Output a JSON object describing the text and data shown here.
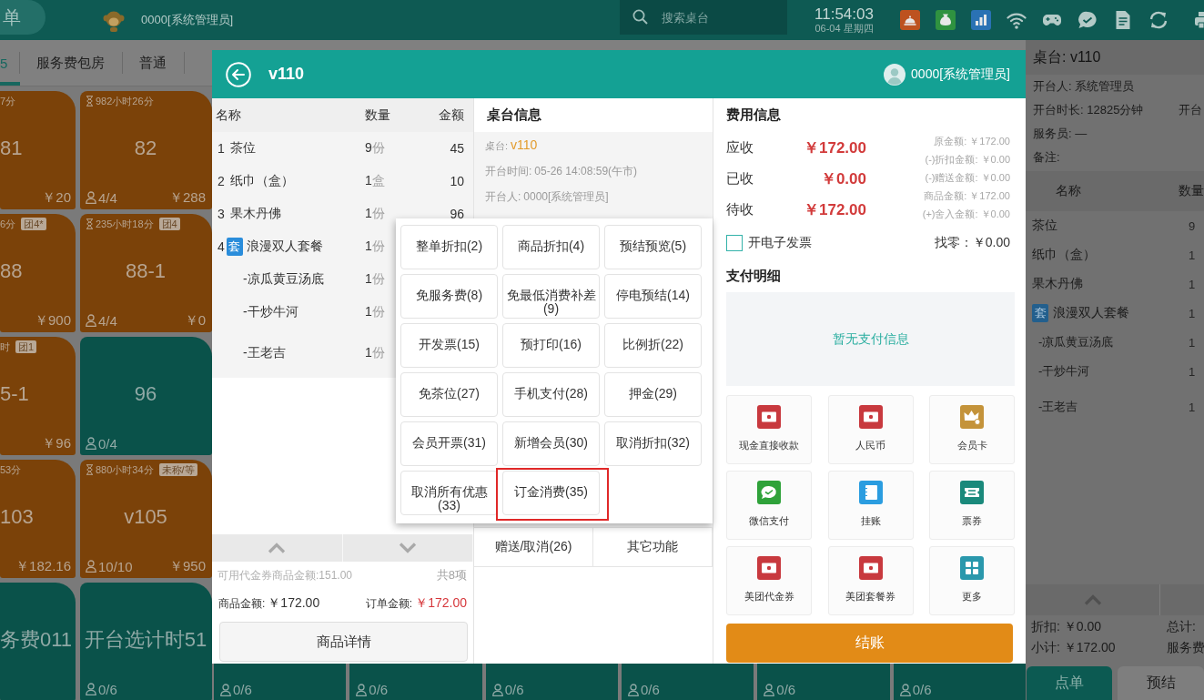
{
  "top_bar": {
    "menu_label": "单",
    "user": "0000[系统管理员]",
    "search": {
      "placeholder": "搜索桌台"
    },
    "time": "11:54:03",
    "date": "06-04 星期四"
  },
  "category_tabs": [
    {
      "label": "5",
      "selected": true
    },
    {
      "label": "服务费包房",
      "selected": false
    },
    {
      "label": "普通",
      "selected": false
    }
  ],
  "tiles": [
    {
      "color": "#7b4209",
      "timer": "7分",
      "name": "81",
      "amount": "￥20"
    },
    {
      "color": "#7b4209",
      "timer": "982小时26分",
      "name": "82",
      "guests": "4/4",
      "amount": "￥288"
    },
    {
      "color": "#7b4209",
      "timer": "6分",
      "badge": "团4*",
      "name": "88",
      "amount": "￥900"
    },
    {
      "color": "#7b4209",
      "timer": "235小时18分",
      "badge": "团4",
      "name": "88-1",
      "guests": "4/4",
      "amount": "￥0"
    },
    {
      "color": "#7b4209",
      "timer": "时",
      "badge": "团1",
      "name": "5-1",
      "amount": "￥96"
    },
    {
      "color": "#0a524a",
      "name": "96",
      "guests": "0/4"
    },
    {
      "color": "#7b4209",
      "timer": "53分",
      "name": "103",
      "amount": "￥182.16"
    },
    {
      "color": "#7b4209",
      "timer": "880小时34分",
      "badge": "未称/等",
      "name": "v105",
      "guests": "10/10",
      "amount": "￥950"
    },
    {
      "color": "#0a524a",
      "name": "务费011"
    },
    {
      "color": "#0a524a",
      "name": "开台选计时51",
      "guests": "0/6"
    }
  ],
  "bottom_tiles": [
    {
      "color": "#0a524a",
      "guests": "0/6"
    },
    {
      "color": "#0a524a",
      "guests": "0/6"
    },
    {
      "color": "#0a524a",
      "guests": "0/6"
    },
    {
      "color": "#0a524a",
      "guests": "0/6"
    },
    {
      "color": "#0a524a",
      "guests": "0/6"
    },
    {
      "color": "#0a524a",
      "guests": "0/6"
    }
  ],
  "side_panel": {
    "title": "桌台: v110",
    "info_rows": [
      [
        "开台人: 系统管理员"
      ],
      [
        "开台时长: 12825分钟",
        "开台"
      ],
      [
        "服务员: —"
      ],
      [
        "备注:"
      ]
    ],
    "columns": [
      "名称",
      "数量"
    ],
    "items": [
      {
        "name": "茶位",
        "qty": "9"
      },
      {
        "name": "纸巾（盒）",
        "qty": "1"
      },
      {
        "name": "果木丹佛",
        "qty": "1"
      },
      {
        "tag": "套",
        "name": "浪漫双人套餐",
        "qty": "1",
        "children": [
          {
            "name": "-凉瓜黄豆汤底",
            "qty": "1"
          },
          {
            "name": "-干炒牛河",
            "qty": "1"
          },
          {
            "name": "-王老吉",
            "qty": "1"
          }
        ]
      }
    ],
    "totals": [
      [
        "折扣: ￥0.00",
        "总计:"
      ],
      [
        "小计: ￥172.00",
        "服务费"
      ]
    ],
    "buttons": [
      {
        "label": "点单",
        "kind": "primary"
      },
      {
        "label": "预结",
        "kind": "secondary"
      }
    ]
  },
  "modal": {
    "title": "v110",
    "user": "0000[系统管理员]",
    "order": {
      "columns": [
        "名称",
        "数量",
        "金额"
      ],
      "items": [
        {
          "index": "1",
          "name": "茶位",
          "qty": "9",
          "unit": "份",
          "amount": "45"
        },
        {
          "index": "2",
          "name": "纸巾（盒）",
          "qty": "1",
          "unit": "盒",
          "amount": "10"
        },
        {
          "index": "3",
          "name": "果木丹佛",
          "qty": "1",
          "unit": "份",
          "amount": "96"
        },
        {
          "index": "4",
          "tag": "套",
          "name": "浪漫双人套餐",
          "qty": "1",
          "unit": "份",
          "children": [
            {
              "name": "-凉瓜黄豆汤底",
              "qty": "1",
              "unit": "份"
            },
            {
              "name": "-干炒牛河",
              "qty": "1",
              "unit": "份"
            },
            {
              "name": "-王老吉",
              "qty": "1",
              "unit": "份"
            }
          ]
        }
      ]
    },
    "voucher_note": "可用代金券商品金额:151.00",
    "item_count": "共8项",
    "totals": [
      {
        "label": "商品金额:",
        "amount": "￥172.00",
        "kind": "plain"
      },
      {
        "label": "订单金额:",
        "amount": "￥172.00",
        "kind": "alert"
      }
    ],
    "detail_button": "商品详情",
    "table_info": {
      "heading": "桌台信息",
      "fields": [
        {
          "label": "桌台:",
          "value": "v110",
          "kind": "accent"
        },
        {
          "label": "开台时间:",
          "value": "05-26 14:08:59(午市)",
          "kind": "plain"
        },
        {
          "label": "开台人:",
          "value": "0000[系统管理员]",
          "kind": "plain"
        }
      ]
    },
    "actions": [
      "赠送/取消(26)",
      "其它功能"
    ],
    "function_menu": [
      {
        "label": "整单折扣(2)",
        "highlighted": false
      },
      {
        "label": "商品折扣(4)",
        "highlighted": false
      },
      {
        "label": "预结预览(5)",
        "highlighted": false
      },
      {
        "label": "免服务费(8)",
        "highlighted": false
      },
      {
        "label": "免最低消费补差(9)",
        "highlighted": false
      },
      {
        "label": "停电预结(14)",
        "highlighted": false
      },
      {
        "label": "开发票(15)",
        "highlighted": false
      },
      {
        "label": "预打印(16)",
        "highlighted": false
      },
      {
        "label": "比例折(22)",
        "highlighted": false
      },
      {
        "label": "免茶位(27)",
        "highlighted": false
      },
      {
        "label": "手机支付(28)",
        "highlighted": false
      },
      {
        "label": "押金(29)",
        "highlighted": false
      },
      {
        "label": "会员开票(31)",
        "highlighted": false
      },
      {
        "label": "新增会员(30)",
        "highlighted": false
      },
      {
        "label": "取消折扣(32)",
        "highlighted": false
      },
      {
        "label": "取消所有优惠(33)",
        "highlighted": false
      },
      {
        "label": "订金消费(35)",
        "highlighted": true
      }
    ],
    "fees": {
      "heading": "费用信息",
      "rows": [
        {
          "label": "应收",
          "amount": "￥172.00"
        },
        {
          "label": "已收",
          "amount": "￥0.00"
        },
        {
          "label": "待收",
          "amount": "￥172.00"
        }
      ],
      "breakdown": [
        "原金额: ￥172.00",
        "(-)折扣金额: ￥0.00",
        "(-)赠送金额: ￥0.00",
        "商品金额: ￥172.00",
        "(+)舍入金额: ￥0.00"
      ],
      "invoice": {
        "label": "开电子发票",
        "checked": false
      },
      "change": "找零：￥0.00"
    },
    "payment": {
      "heading": "支付明细",
      "empty_text": "暂无支付信息",
      "methods": [
        {
          "label": "现金直接收款",
          "kind": "cash"
        },
        {
          "label": "人民币",
          "kind": "cash"
        },
        {
          "label": "会员卡",
          "kind": "member"
        },
        {
          "label": "微信支付",
          "kind": "wechat"
        },
        {
          "label": "挂账",
          "kind": "credit"
        },
        {
          "label": "票券",
          "kind": "ticket"
        },
        {
          "label": "美团代金券",
          "kind": "cash"
        },
        {
          "label": "美团套餐券",
          "kind": "cash"
        },
        {
          "label": "更多",
          "kind": "more"
        }
      ]
    },
    "checkout_button": "结账"
  }
}
